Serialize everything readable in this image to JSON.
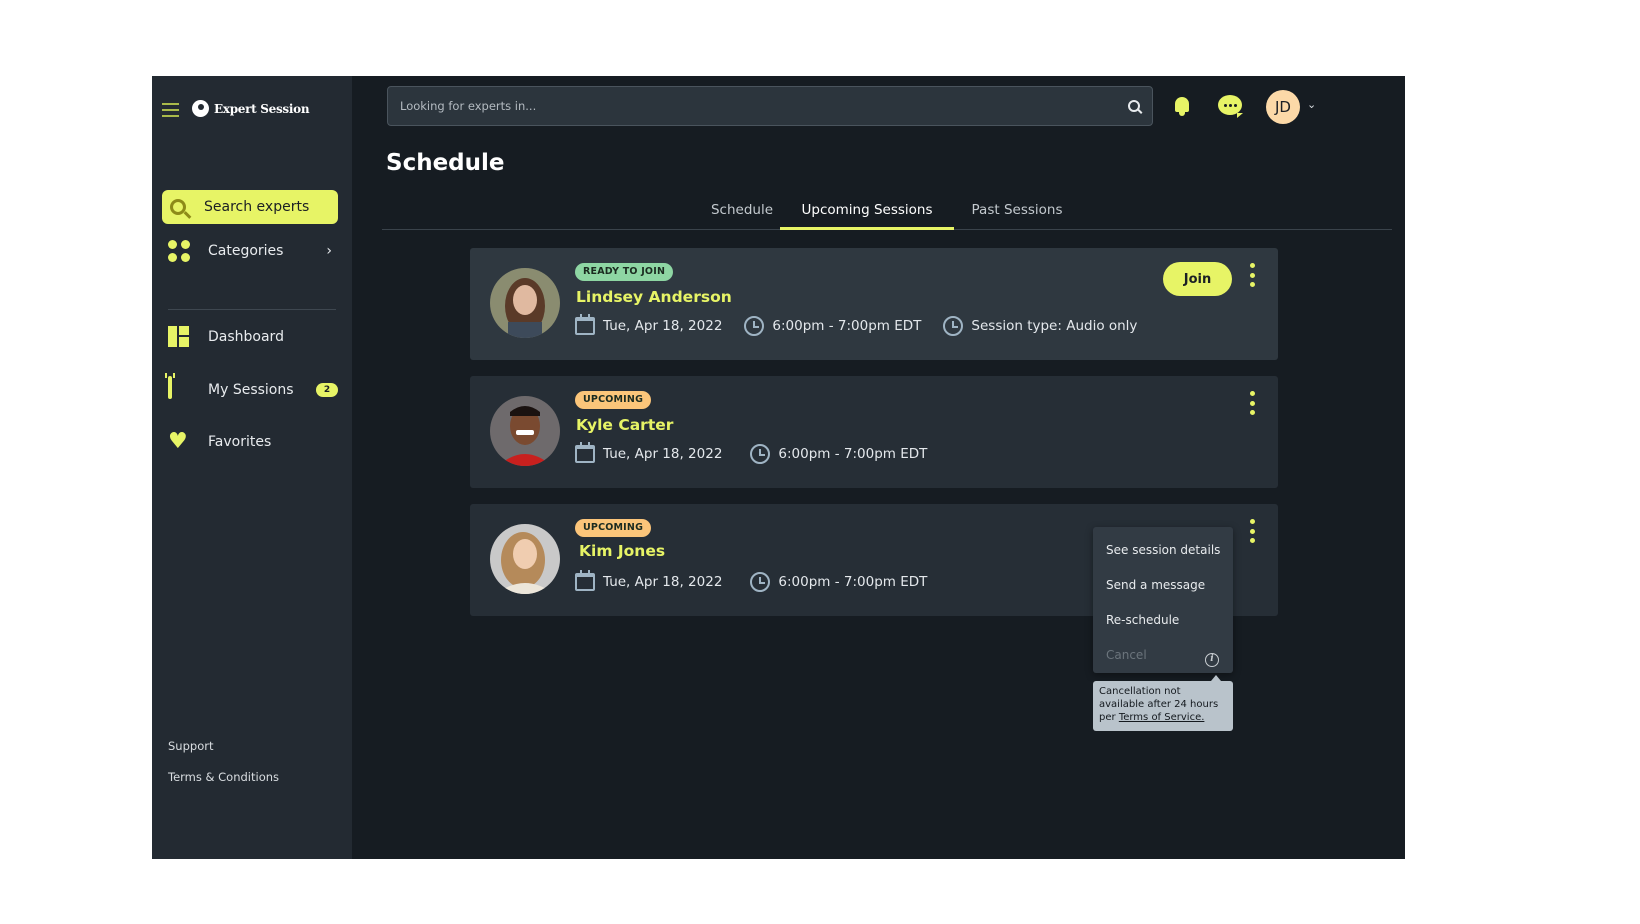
{
  "brand": {
    "name": "Expert Session"
  },
  "colors": {
    "accent": "#e7f466",
    "sidebar_bg": "#232a32",
    "main_bg": "#161c22",
    "card_bg": "#2f3840",
    "ready_badge": "#8ed6a3",
    "upcoming_badge": "#fbc57a"
  },
  "sidebar": {
    "search_label": "Search experts",
    "categories_label": "Categories",
    "items": [
      {
        "label": "Dashboard",
        "icon": "dashboard-icon"
      },
      {
        "label": "My Sessions",
        "icon": "calendar-icon",
        "badge": "2"
      },
      {
        "label": "Favorites",
        "icon": "heart-icon"
      }
    ],
    "footer": [
      "Support",
      "Terms & Conditions"
    ]
  },
  "topbar": {
    "search_placeholder": "Looking for experts in...",
    "user_initials": "JD"
  },
  "page": {
    "title": "Schedule",
    "tabs": [
      {
        "label": "Schedule",
        "active": false
      },
      {
        "label": "Upcoming Sessions",
        "active": true
      },
      {
        "label": "Past Sessions",
        "active": false
      }
    ]
  },
  "sessions": [
    {
      "status": "READY TO JOIN",
      "name": "Lindsey Anderson",
      "date": "Tue, Apr 18, 2022",
      "time": "6:00pm - 7:00pm EDT",
      "session_type": "Session type: Audio only",
      "join_label": "Join"
    },
    {
      "status": "UPCOMING",
      "name": "Kyle Carter",
      "date": "Tue, Apr 18, 2022",
      "time": "6:00pm - 7:00pm EDT"
    },
    {
      "status": "UPCOMING",
      "name": "Kim Jones",
      "date": "Tue, Apr 18, 2022",
      "time": "6:00pm - 7:00pm EDT"
    }
  ],
  "menu": {
    "items": [
      "See session details",
      "Send a message",
      "Re-schedule",
      "Cancel"
    ],
    "tooltip_text": "Cancellation not available after 24 hours per",
    "tooltip_link": "Terms of Service."
  }
}
